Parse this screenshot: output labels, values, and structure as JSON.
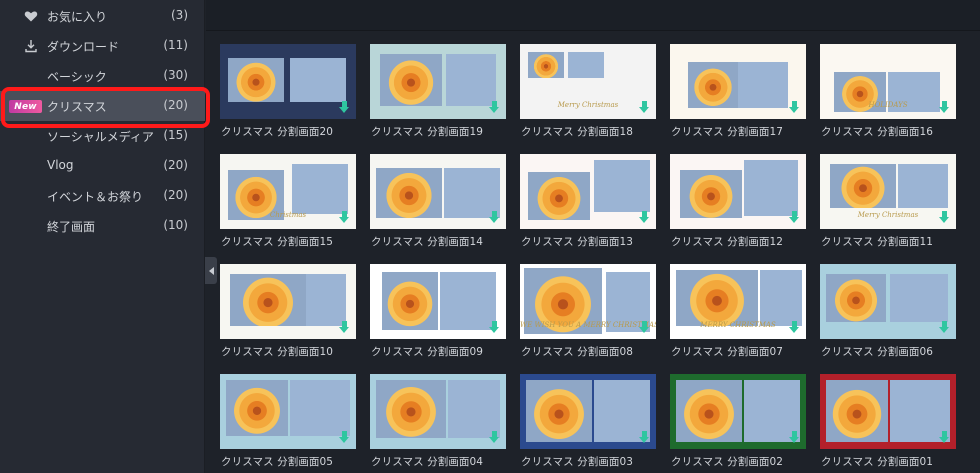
{
  "sidebar": {
    "items": [
      {
        "icon": "heart-icon",
        "label": "お気に入り",
        "count": "(3)"
      },
      {
        "icon": "download-icon",
        "label": "ダウンロード",
        "count": "(11)"
      },
      {
        "icon": "",
        "label": "ベーシック",
        "count": "(30)"
      },
      {
        "icon": "new-badge",
        "badge": "New",
        "label": "クリスマス",
        "count": "(20)"
      },
      {
        "icon": "",
        "label": "ソーシャルメディア",
        "count": "(15)"
      },
      {
        "icon": "",
        "label": "Vlog",
        "count": "(20)"
      },
      {
        "icon": "",
        "label": "イベント＆お祭り",
        "count": "(20)"
      },
      {
        "icon": "",
        "label": "終了画面",
        "count": "(10)"
      }
    ]
  },
  "templates": [
    {
      "name": "クリスマス 分割画面20",
      "bg": "#2b3a5e",
      "frame_text": ""
    },
    {
      "name": "クリスマス 分割画面19",
      "bg": "#b9d6d8",
      "frame_text": ""
    },
    {
      "name": "クリスマス 分割画面18",
      "bg": "#f3f3f3",
      "frame_text": "Merry Christmas"
    },
    {
      "name": "クリスマス 分割画面17",
      "bg": "#fbf7ee",
      "frame_text": ""
    },
    {
      "name": "クリスマス 分割画面16",
      "bg": "#fbf8f2",
      "frame_text": "HOLIDAYS"
    },
    {
      "name": "クリスマス 分割画面15",
      "bg": "#f6f6f2",
      "frame_text": "Christmas"
    },
    {
      "name": "クリスマス 分割画面14",
      "bg": "#f6f6f2",
      "frame_text": ""
    },
    {
      "name": "クリスマス 分割画面13",
      "bg": "#fbf6f4",
      "frame_text": ""
    },
    {
      "name": "クリスマス 分割画面12",
      "bg": "#fbf6f4",
      "frame_text": ""
    },
    {
      "name": "クリスマス 分割画面11",
      "bg": "#f7f7f2",
      "frame_text": "Merry Christmas"
    },
    {
      "name": "クリスマス 分割画面10",
      "bg": "#f7f7f2",
      "frame_text": ""
    },
    {
      "name": "クリスマス 分割画面09",
      "bg": "#ffffff",
      "frame_text": ""
    },
    {
      "name": "クリスマス 分割画面08",
      "bg": "#ffffff",
      "frame_text": "WE WISH YOU A MERRY CHRISTMAS"
    },
    {
      "name": "クリスマス 分割画面07",
      "bg": "#ffffff",
      "frame_text": "MERRY CHRISTMAS"
    },
    {
      "name": "クリスマス 分割画面06",
      "bg": "#a9d0de",
      "frame_text": ""
    },
    {
      "name": "クリスマス 分割画面05",
      "bg": "#a9d0de",
      "frame_text": ""
    },
    {
      "name": "クリスマス 分割画面04",
      "bg": "#a9d0de",
      "frame_text": ""
    },
    {
      "name": "クリスマス 分割画面03",
      "bg": "#2b4a8e",
      "frame_text": ""
    },
    {
      "name": "クリスマス 分割画面02",
      "bg": "#1e6b2d",
      "frame_text": ""
    },
    {
      "name": "クリスマス 分割画面01",
      "bg": "#b3202a",
      "frame_text": ""
    }
  ],
  "colors": {
    "accent_download": "#2fc6a0",
    "highlight": "#ff1a1a",
    "sidebar_bg": "#262a33",
    "main_bg": "#1e2229"
  }
}
